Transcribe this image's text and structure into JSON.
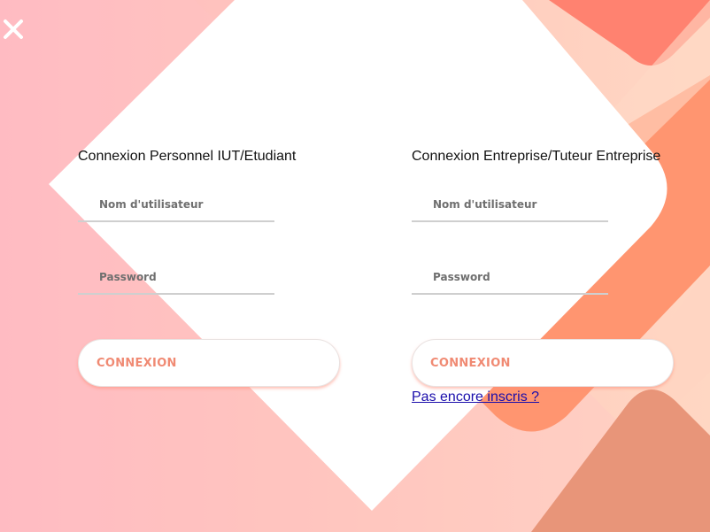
{
  "login": {
    "personnel": {
      "title": "Connexion Personnel IUT/Etudiant",
      "username_placeholder": "Nom d'utilisateur",
      "password_placeholder": "Password",
      "button_label": "CONNEXION"
    },
    "entreprise": {
      "title": "Connexion Entreprise/Tuteur Entreprise",
      "username_placeholder": "Nom d'utilisateur",
      "password_placeholder": "Password",
      "button_label": "CONNEXION",
      "register_link": "Pas encore inscris ?"
    }
  },
  "icons": {
    "close": "close-icon"
  },
  "colors": {
    "accent": "#f08a73",
    "shape_coral": "#ff8470",
    "shape_orange": "#ff9a74",
    "shape_tan": "#e79679",
    "link": "#1a0dab"
  }
}
